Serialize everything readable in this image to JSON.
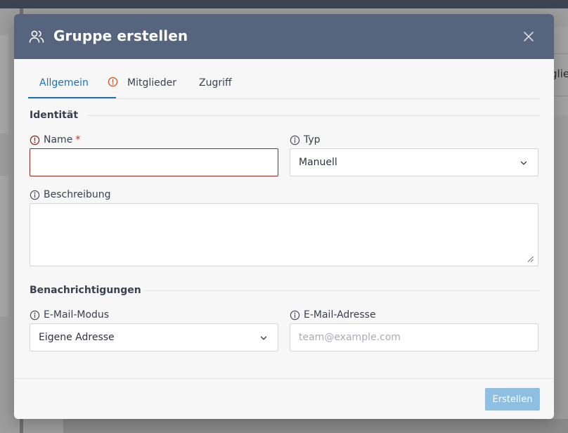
{
  "background": {
    "peek_text": "glie"
  },
  "dialog": {
    "title": "Gruppe erstellen",
    "icon": "users-icon",
    "close_icon": "close-icon"
  },
  "tabs": [
    {
      "label": "Allgemein",
      "active": true,
      "warning": true
    },
    {
      "label": "Mitglieder",
      "active": false
    },
    {
      "label": "Zugriff",
      "active": false
    }
  ],
  "sections": {
    "identity": "Identität",
    "notifications": "Benachrichtigungen"
  },
  "fields": {
    "name": {
      "label": "Name",
      "required_marker": "*",
      "value": "",
      "icon": "error-circle-icon"
    },
    "type": {
      "label": "Typ",
      "selected": "Manuell",
      "icon": "info-circle-icon"
    },
    "description": {
      "label": "Beschreibung",
      "value": "",
      "icon": "info-circle-icon"
    },
    "email_mode": {
      "label": "E-Mail-Modus",
      "selected": "Eigene Adresse",
      "icon": "info-circle-icon"
    },
    "email_address": {
      "label": "E-Mail-Adresse",
      "placeholder": "team@example.com",
      "value": "",
      "icon": "info-circle-icon"
    }
  },
  "footer": {
    "submit_label": "Erstellen"
  },
  "colors": {
    "header_bg": "#56647d",
    "accent": "#1a73b4",
    "error": "#8e2a1f",
    "submit_disabled": "#8dbfe3"
  }
}
